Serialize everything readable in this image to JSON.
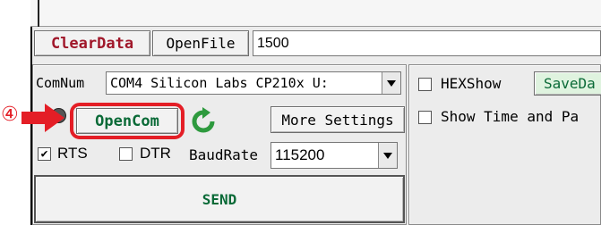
{
  "toolbar": {
    "clear_data_label": "ClearData",
    "open_file_label": "OpenFile",
    "file_path_value": "1500"
  },
  "com": {
    "port_label": "ComNum",
    "port_value": "COM4 Silicon Labs CP210x U:",
    "open_com_label": "OpenCom",
    "more_settings_label": "More Settings",
    "rts_label": "RTS",
    "rts_checked": true,
    "dtr_label": "DTR",
    "dtr_checked": false,
    "baud_label": "BaudRate",
    "baud_value": "115200",
    "send_label": "SEND"
  },
  "options": {
    "hex_show_label": "HEXShow",
    "save_data_label": "SaveDa",
    "show_time_label": "Show Time and Pa"
  },
  "annotation": {
    "step_marker": "④"
  },
  "colors": {
    "clear_data_text": "#a0172a",
    "open_com_text": "#0a6a37",
    "highlight_red": "#e41e26",
    "refresh_green": "#2e9a3e",
    "save_data_bg": "#dff3df"
  }
}
